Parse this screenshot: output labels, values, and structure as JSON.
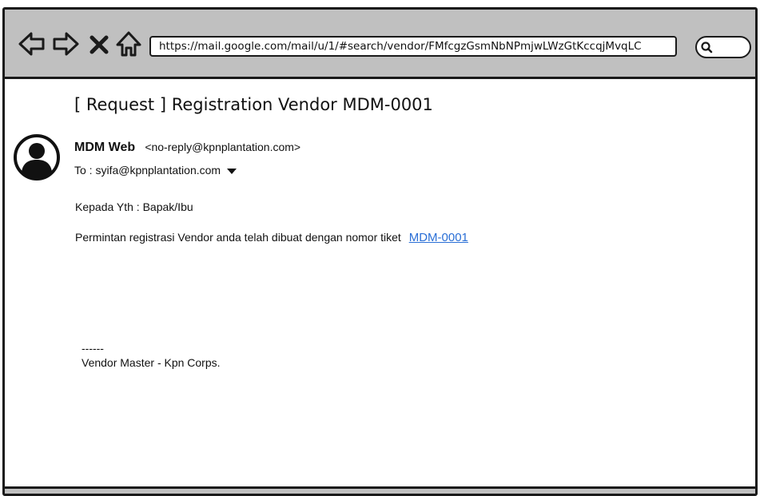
{
  "browser": {
    "url": "https://mail.google.com/mail/u/1/#search/vendor/FMfcgzGsmNbNPmjwLWzGtKccqjMvqLC",
    "icons": [
      "back-arrow-icon",
      "forward-arrow-icon",
      "stop-icon",
      "home-icon",
      "search-icon"
    ]
  },
  "email": {
    "subject": "[ Request ] Registration Vendor MDM-0001",
    "sender_name": "MDM Web",
    "sender_email": "<no-reply@kpnplantation.com>",
    "to": "To : syifa@kpnplantation.com",
    "greeting": "Kepada Yth : Bapak/Ibu",
    "message": "Permintan registrasi Vendor anda telah dibuat dengan nomor tiket",
    "ticket_link": "MDM-0001",
    "signature_dash": "------",
    "signature": "Vendor Master - Kpn Corps."
  }
}
